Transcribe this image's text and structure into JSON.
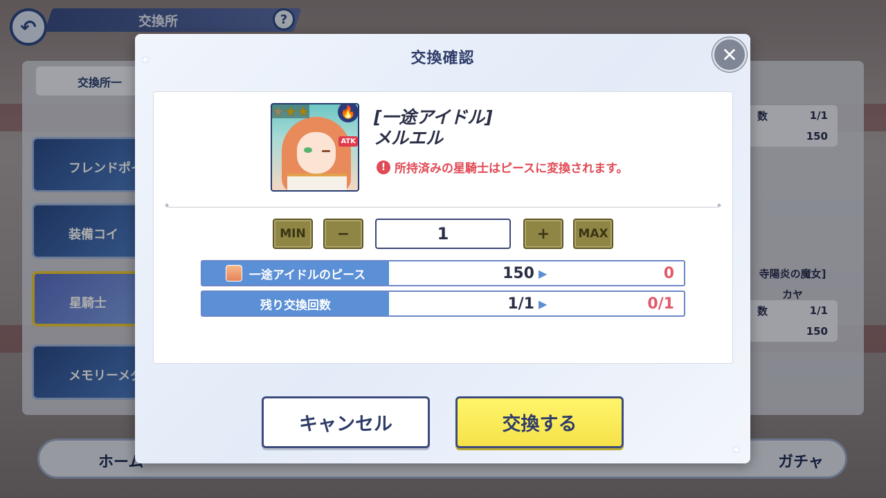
{
  "background": {
    "header_title": "交換所",
    "back_icon": "back-arrow-icon",
    "help_label": "?",
    "list_title": "交換所一",
    "categories": [
      {
        "label": "フレンドポイ",
        "icon": "handshake-icon"
      },
      {
        "label": "装備コイ",
        "icon": "gear-icon"
      },
      {
        "label": "星騎士",
        "icon": "star-icon",
        "selected": true
      },
      {
        "label": "メモリーメダ",
        "icon": "clock-icon"
      }
    ],
    "right_cards": [
      {
        "count_label": "数",
        "count": "1/1",
        "price": "150"
      },
      {
        "name_line1": "寺陽炎の魔女]",
        "name_line2": "カヤ",
        "count_label": "数",
        "count": "1/1",
        "price": "150"
      }
    ],
    "bottom_nav": {
      "home": "ホーム",
      "gacha": "ガチャ"
    }
  },
  "modal": {
    "title": "交換確認",
    "close_icon": "close-icon",
    "item": {
      "name_line1": "[一途アイドル]",
      "name_line2": "メルエル",
      "rarity": 3,
      "rarity_max": 4,
      "element_icon": "fire-icon",
      "role_badge": "ATK",
      "notice": "所持済みの星騎士はピースに変換されます。",
      "notice_icon": "!"
    },
    "quantity": {
      "min_label": "MIN",
      "minus_label": "−",
      "value": "1",
      "plus_label": "+",
      "max_label": "MAX"
    },
    "rows": [
      {
        "label": "一途アイドルのピース",
        "before": "150",
        "after": "0",
        "has_icon": true
      },
      {
        "label": "残り交換回数",
        "before": "1/1",
        "after": "0/1",
        "has_icon": false
      }
    ],
    "buttons": {
      "cancel": "キャンセル",
      "confirm": "交換する"
    }
  }
}
